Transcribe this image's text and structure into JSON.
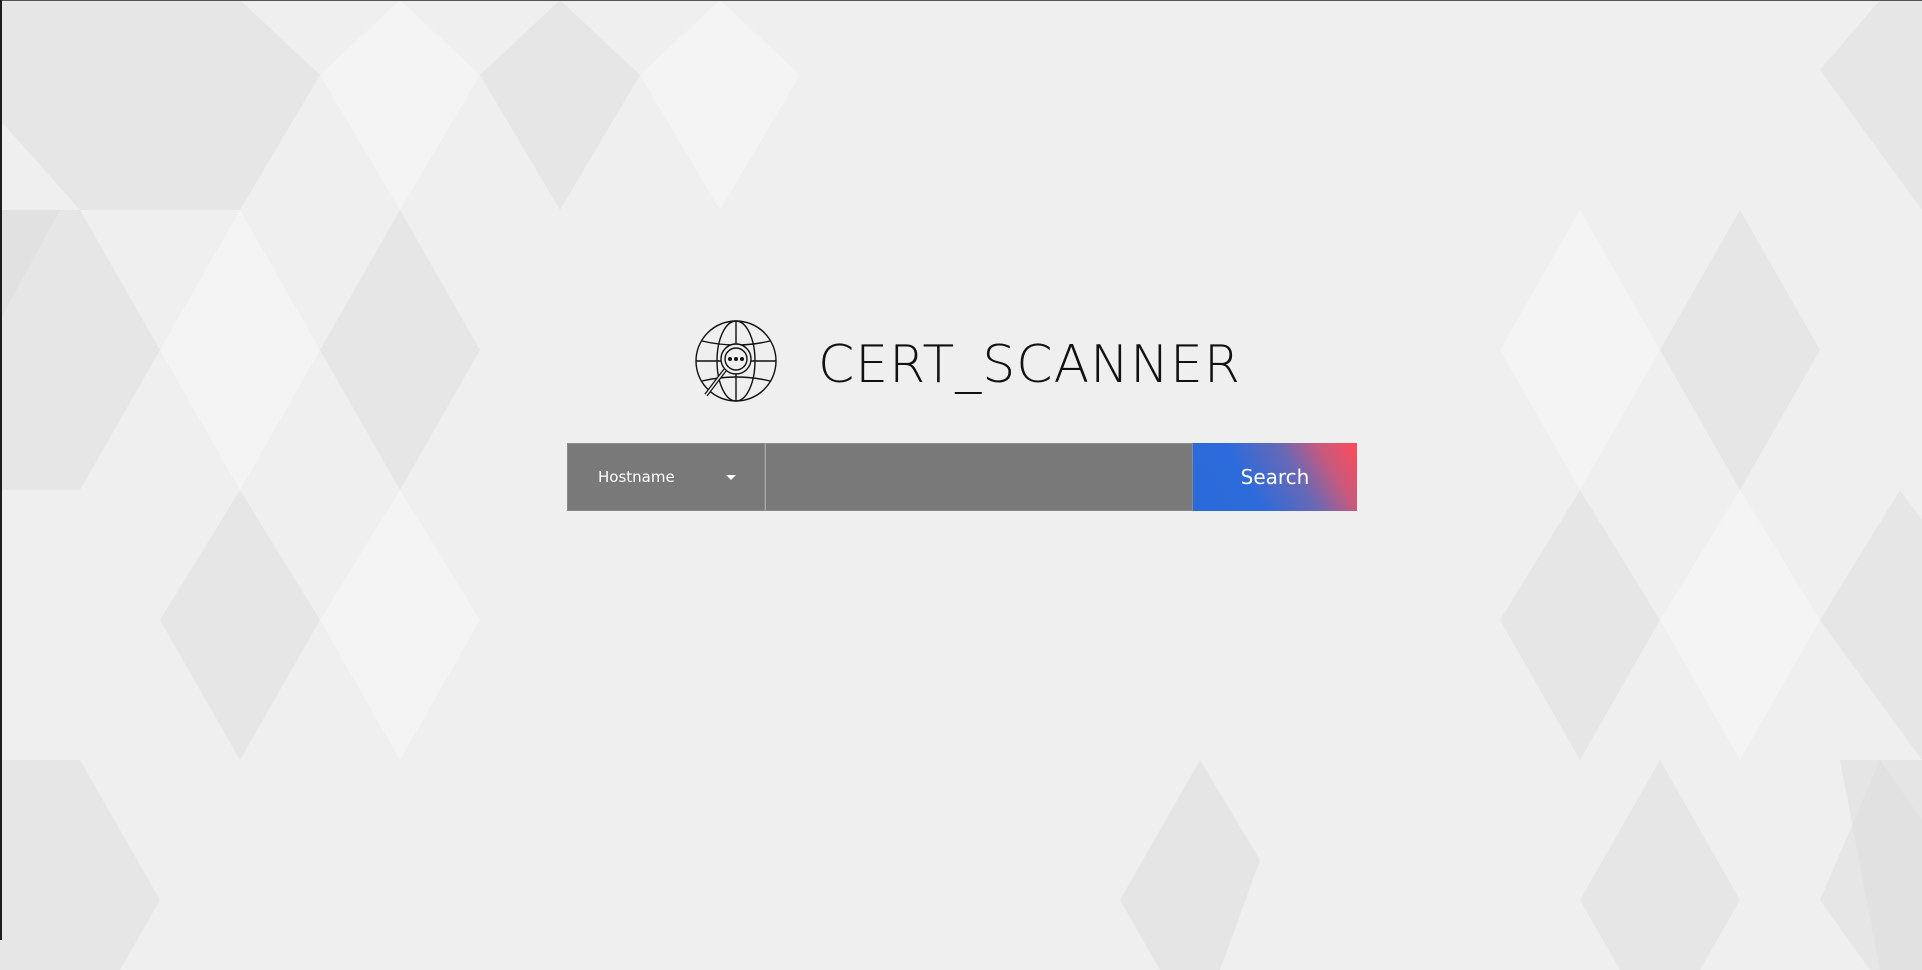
{
  "app": {
    "title": "CERT_SCANNER",
    "logo_icon": "globe-magnifier-icon"
  },
  "search": {
    "type_selected": "Hostname",
    "type_icon": "caret-down-icon",
    "query_value": "",
    "query_placeholder": "",
    "button_label": "Search"
  },
  "colors": {
    "background": "#efefef",
    "bar": "#797979",
    "button_gradient_start": "#2a6ad9",
    "button_gradient_end": "#ff4b57",
    "title": "#111111"
  }
}
